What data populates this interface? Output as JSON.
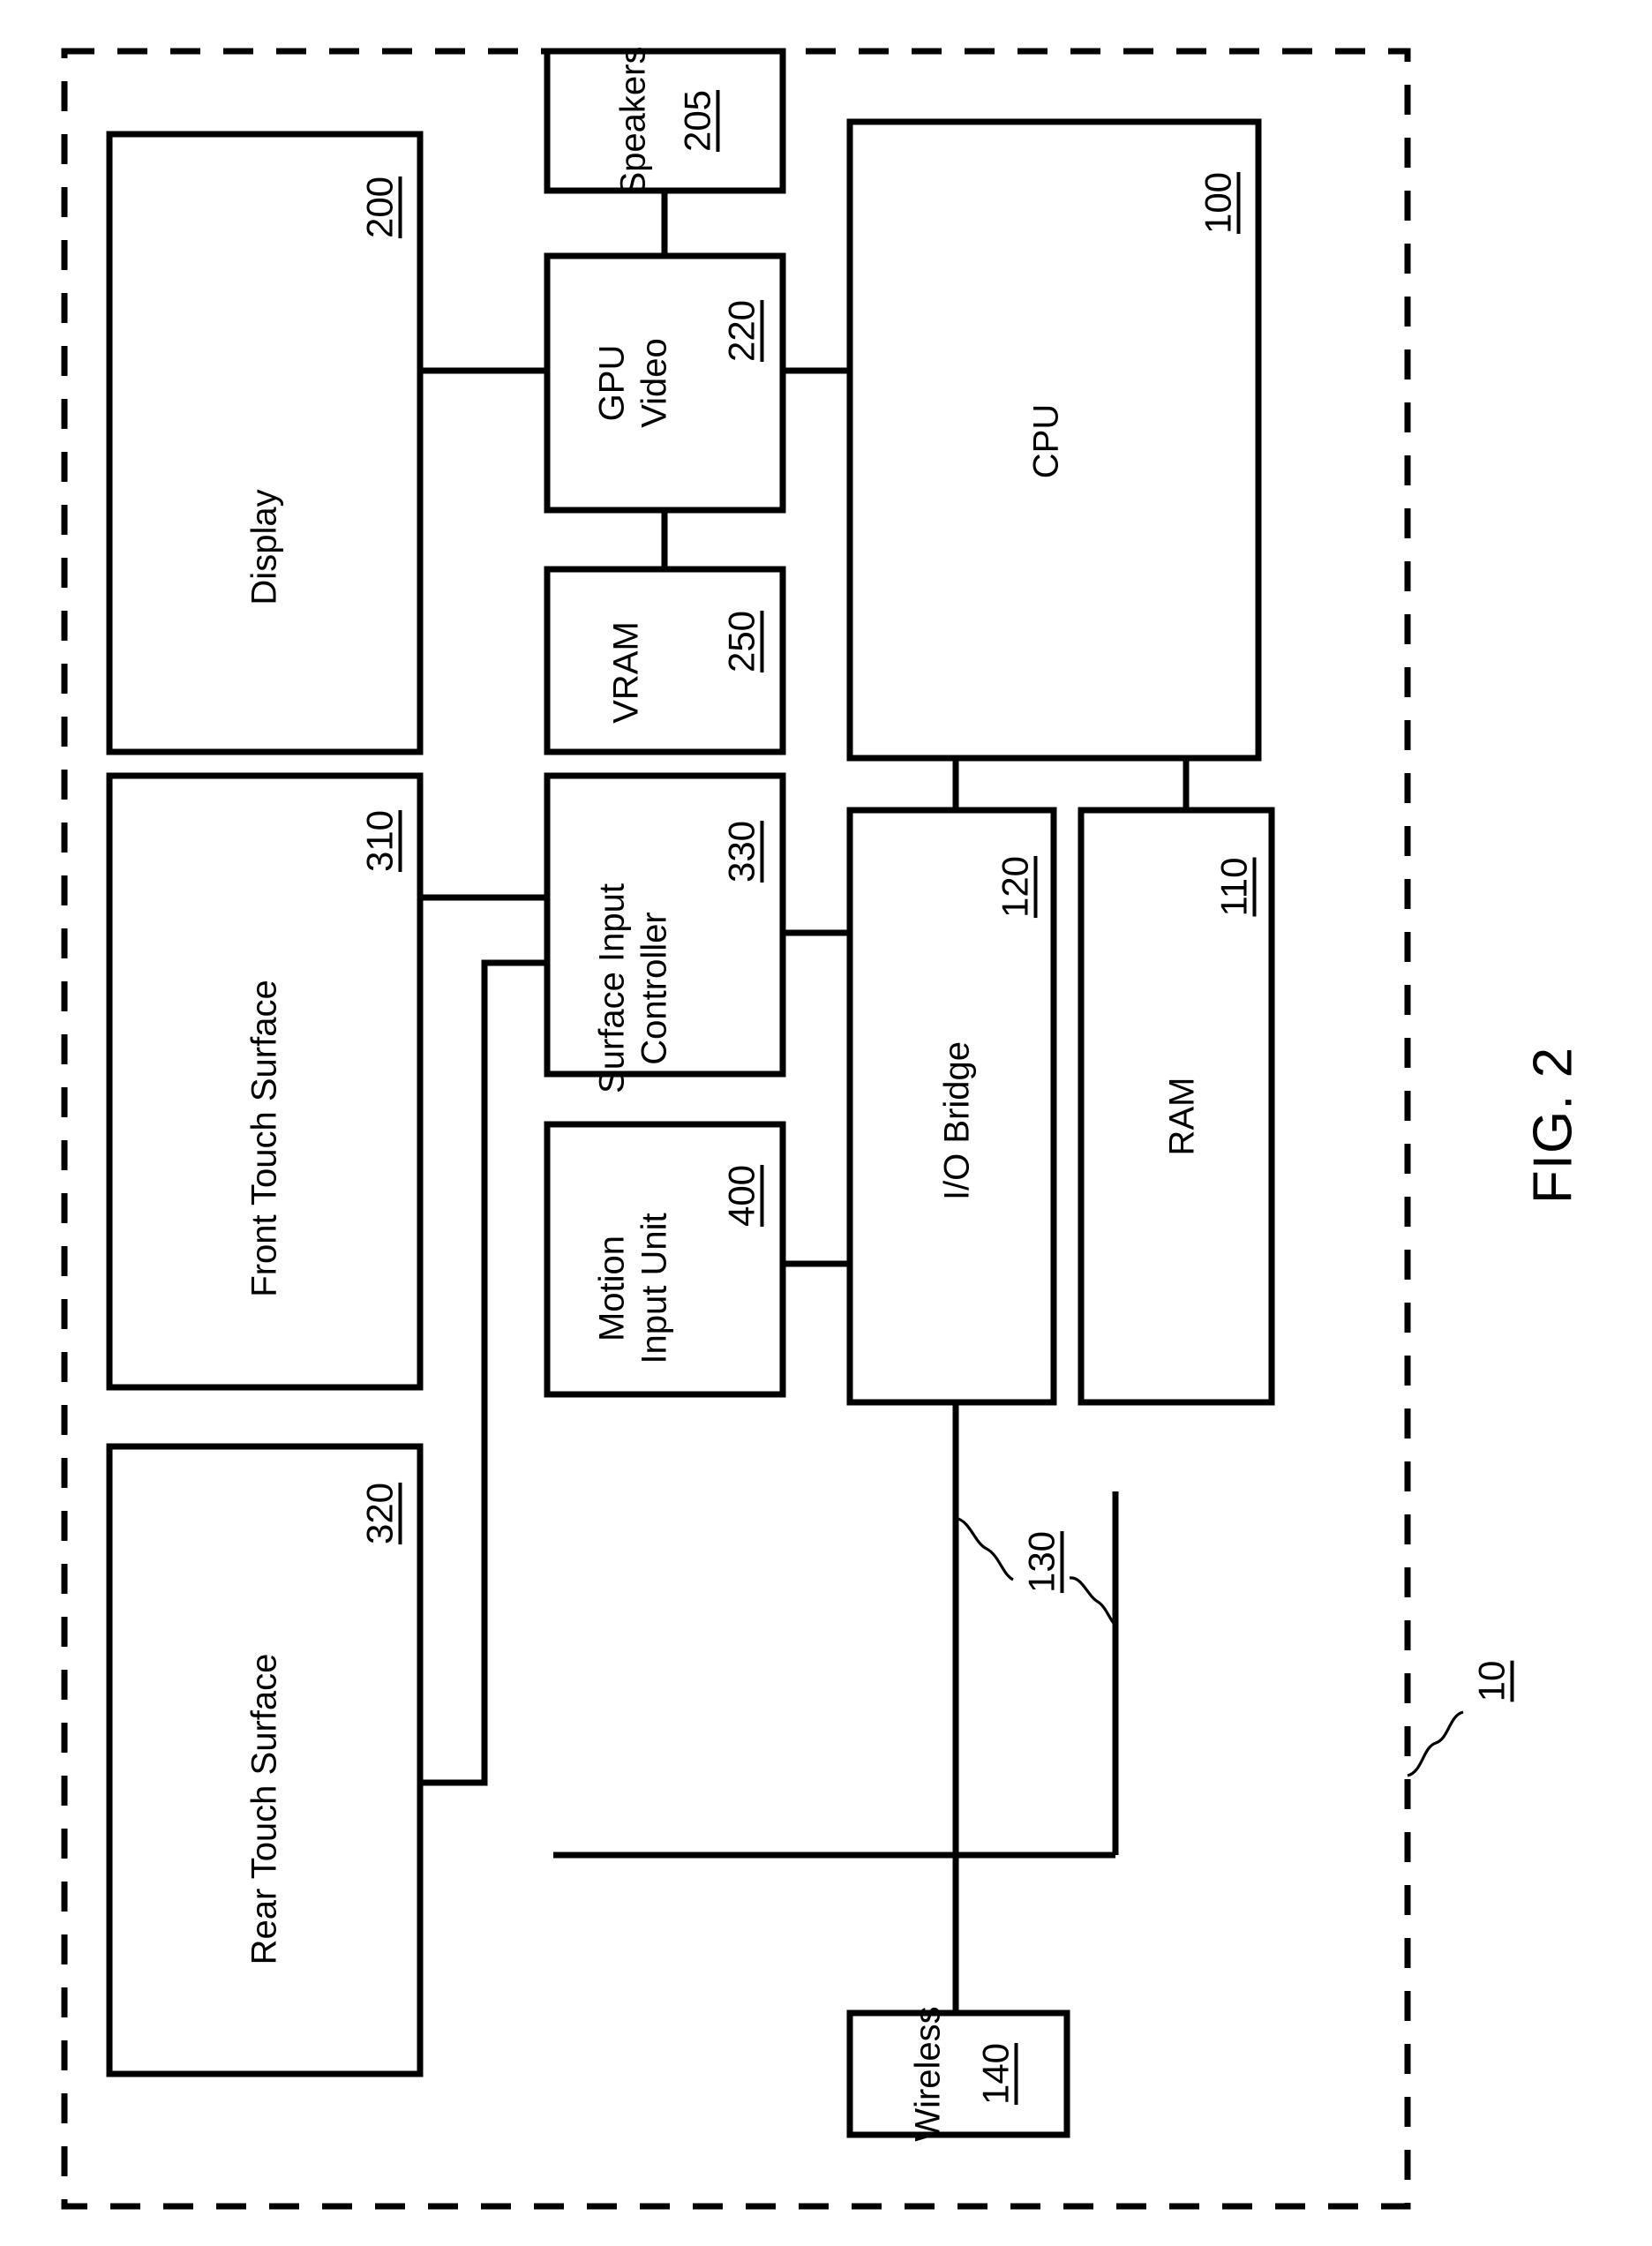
{
  "figure": {
    "caption": "FIG. 2",
    "system_reference": "10",
    "bus_reference": "130"
  },
  "blocks": [
    {
      "key": "display",
      "label": "Display",
      "ref": "200"
    },
    {
      "key": "speakers",
      "label": "Speakers",
      "ref": "205"
    },
    {
      "key": "gpu_video",
      "label": "GPU\nVideo",
      "label_line1": "GPU",
      "label_line2": "Video",
      "ref": "220"
    },
    {
      "key": "vram",
      "label": "VRAM",
      "ref": "250"
    },
    {
      "key": "cpu",
      "label": "CPU",
      "ref": "100"
    },
    {
      "key": "front_touch",
      "label": "Front Touch Surface",
      "ref": "310"
    },
    {
      "key": "surface_input",
      "label": "Surface Input\nController",
      "label_line1": "Surface Input",
      "label_line2": "Controller",
      "ref": "330"
    },
    {
      "key": "io_bridge",
      "label": "I/O Bridge",
      "ref": "120"
    },
    {
      "key": "ram",
      "label": "RAM",
      "ref": "110"
    },
    {
      "key": "motion_input",
      "label": "Motion\nInput Unit",
      "label_line1": "Motion",
      "label_line2": "Input Unit",
      "ref": "400"
    },
    {
      "key": "rear_touch",
      "label": "Rear Touch Surface",
      "ref": "320"
    },
    {
      "key": "wireless",
      "label": "Wireless",
      "ref": "140"
    }
  ],
  "connections": [
    {
      "from": "display",
      "to": "gpu_video"
    },
    {
      "from": "speakers",
      "to": "gpu_video"
    },
    {
      "from": "gpu_video",
      "to": "cpu"
    },
    {
      "from": "gpu_video",
      "to": "vram"
    },
    {
      "from": "cpu",
      "to": "io_bridge"
    },
    {
      "from": "cpu",
      "to": "ram"
    },
    {
      "from": "front_touch",
      "to": "surface_input"
    },
    {
      "from": "rear_touch",
      "to": "surface_input"
    },
    {
      "from": "surface_input",
      "to": "io_bridge"
    },
    {
      "from": "motion_input",
      "to": "io_bridge"
    },
    {
      "from": "io_bridge",
      "to": "wireless"
    },
    {
      "from": "io_bridge",
      "to": "bus_130"
    }
  ],
  "colors": {
    "line": "#000000",
    "background": "#ffffff",
    "text": "#000000"
  }
}
